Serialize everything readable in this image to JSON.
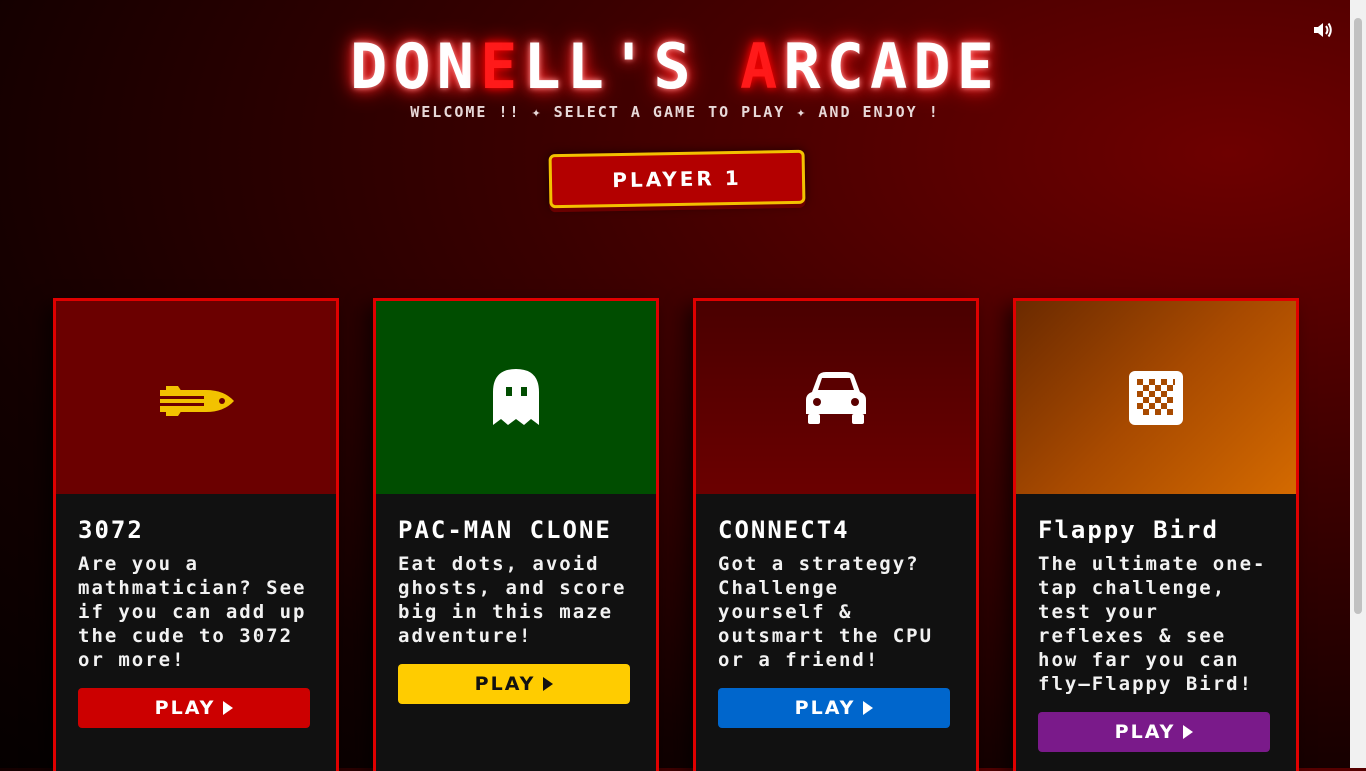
{
  "header": {
    "title_part1": "DON",
    "title_accent1": "E",
    "title_part2": "LL'S ",
    "title_accent2": "A",
    "title_part3": "RCADE",
    "subtitle": "WELCOME !! ✦ SELECT A GAME TO PLAY ✦ AND ENJOY !",
    "player_label": "PLAYER 1",
    "sound_icon": "speaker-icon"
  },
  "games": [
    {
      "title": "3072",
      "description": "Are you a mathmatician? See if you can add up the cude to 3072 or more!",
      "play_label": "PLAY",
      "icon": "rocket-icon",
      "top_color": "#6b0000",
      "button_color": "#cc0000",
      "button_text_color": "#ffffff"
    },
    {
      "title": "PAC-MAN CLONE",
      "description": "Eat dots, avoid ghosts, and score big in this maze adventure!",
      "play_label": "PLAY",
      "icon": "ghost-icon",
      "top_color": "#004d00",
      "button_color": "#ffcc00",
      "button_text_color": "#111111"
    },
    {
      "title": "CONNECT4",
      "description": "Got a strategy? Challenge yourself & outsmart the CPU or a friend!",
      "play_label": "PLAY",
      "icon": "car-icon",
      "top_color": "#5a0000",
      "button_color": "#0066cc",
      "button_text_color": "#ffffff"
    },
    {
      "title": "Flappy Bird",
      "description": "The ultimate one-tap challenge, test your reflexes & see how far you can fly—Flappy Bird!",
      "play_label": "PLAY",
      "icon": "checkerboard-icon",
      "top_color": "#c45f00",
      "button_color": "#7a1a8a",
      "button_text_color": "#ffffff"
    }
  ]
}
